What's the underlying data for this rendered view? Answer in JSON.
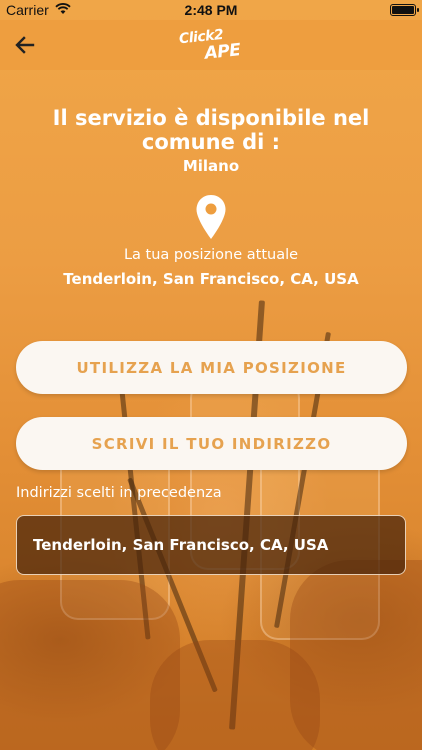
{
  "status_bar": {
    "carrier": "Carrier",
    "time": "2:48 PM"
  },
  "nav": {
    "back_icon": "back-arrow-icon",
    "logo_line1": "Click2",
    "logo_line2": "APE"
  },
  "main": {
    "headline": "Il servizio è disponibile nel comune di :",
    "city": "Milano",
    "pin_icon": "location-pin-icon",
    "position_label": "La tua posizione attuale",
    "position_value": "Tenderloin, San Francisco, CA, USA"
  },
  "buttons": {
    "use_position": "UTILIZZA LA MIA POSIZIONE",
    "write_address": "SCRIVI IL TUO INDIRIZZO"
  },
  "recent": {
    "label": "Indirizzi scelti in precedenza",
    "items": [
      "Tenderloin, San Francisco, CA, USA"
    ]
  },
  "colors": {
    "accent": "#ee9e3f",
    "button_text": "#e6a24f",
    "button_bg": "#fbf7f2"
  }
}
